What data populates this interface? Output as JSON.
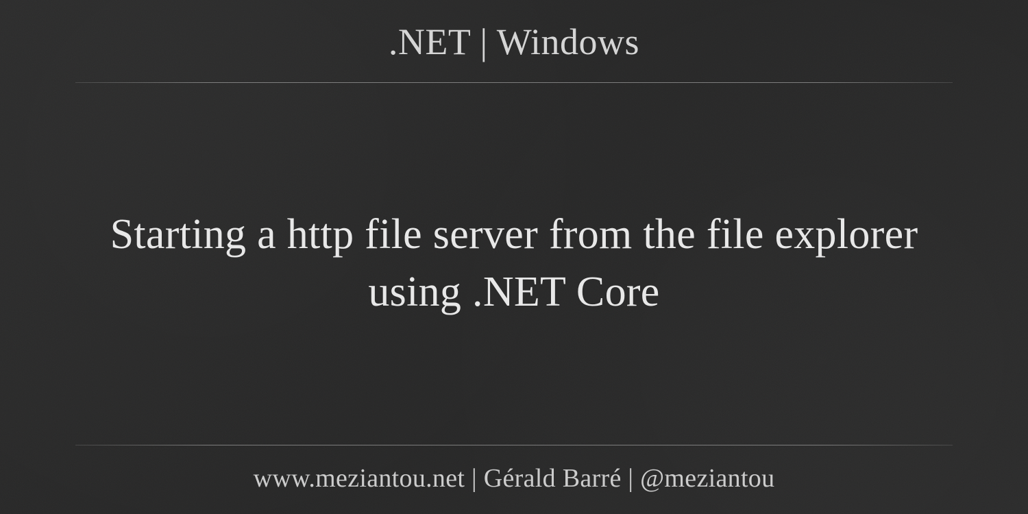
{
  "header": {
    "categories": ".NET  |  Windows"
  },
  "main": {
    "title": "Starting a http file server from the file explorer using .NET Core"
  },
  "footer": {
    "text": "www.meziantou.net  |  Gérald Barré  |  @meziantou"
  }
}
